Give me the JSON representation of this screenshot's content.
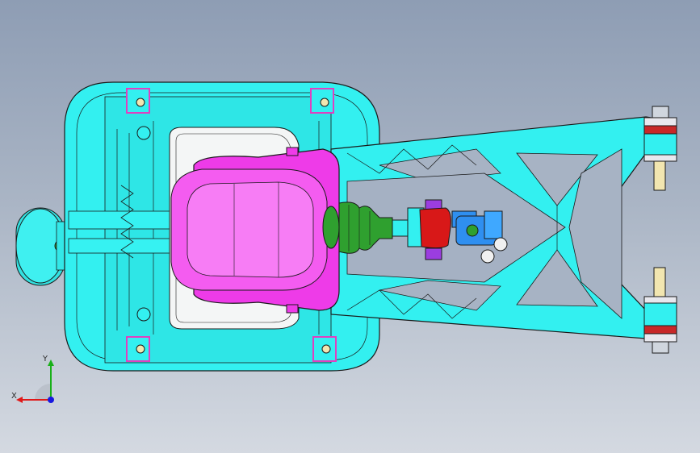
{
  "viewport": {
    "background_top": "#8e9db4",
    "background_bottom": "#d4d9e1"
  },
  "model": {
    "colors": {
      "housing": "#33f0f0",
      "shift_boot": "#ee3be8",
      "rubber_boot": "#2fa02f",
      "rod_end": "#d81818",
      "clevis": "#2f8ff0",
      "bushing": "#d03030",
      "bolt": "#f2e6b0",
      "outline": "#1a1a1a"
    }
  },
  "triad": {
    "x_label": "X",
    "y_label": "Y",
    "x_color": "#e01818",
    "y_color": "#18b018",
    "z_color": "#1818e0",
    "icon": "coordinate-triad-icon"
  }
}
